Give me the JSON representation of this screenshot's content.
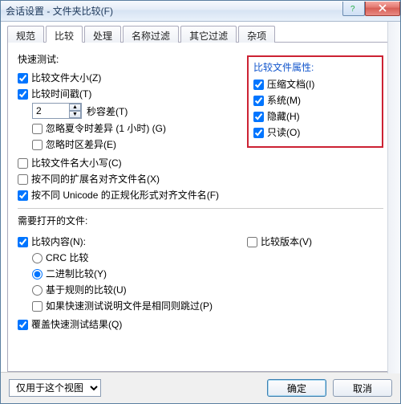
{
  "window": {
    "title": "会话设置 - 文件夹比较(F)"
  },
  "tabs": {
    "items": [
      {
        "label": "规范"
      },
      {
        "label": "比较"
      },
      {
        "label": "处理"
      },
      {
        "label": "名称过滤"
      },
      {
        "label": "其它过滤"
      },
      {
        "label": "杂项"
      }
    ],
    "active_index": 1
  },
  "quick_test": {
    "title": "快速测试:",
    "compare_size": {
      "label": "比较文件大小(Z)",
      "checked": true
    },
    "compare_timestamp": {
      "label": "比较时间戳(T)",
      "checked": true
    },
    "seconds_diff_value": "2",
    "seconds_diff_label": "秒容差(T)",
    "ignore_dst": {
      "label": "忽略夏令时差异 (1 小时) (G)",
      "checked": false
    },
    "ignore_tz": {
      "label": "忽略时区差异(E)",
      "checked": false
    }
  },
  "attributes": {
    "title": "比较文件属性:",
    "items": [
      {
        "label": "压缩文档(I)",
        "checked": true
      },
      {
        "label": "系统(M)",
        "checked": true
      },
      {
        "label": "隐藏(H)",
        "checked": true
      },
      {
        "label": "只读(O)",
        "checked": true
      }
    ]
  },
  "mid_options": {
    "case_sensitive": {
      "label": "比较文件名大小写(C)",
      "checked": false
    },
    "align_ext": {
      "label": "按不同的扩展名对齐文件名(X)",
      "checked": false
    },
    "align_unicode": {
      "label": "按不同 Unicode 的正规化形式对齐文件名(F)",
      "checked": true
    }
  },
  "open_files": {
    "title": "需要打开的文件:",
    "compare_content": {
      "label": "比较内容(N):",
      "checked": true
    },
    "compare_version": {
      "label": "比较版本(V)",
      "checked": false
    },
    "radio": {
      "selected": "binary",
      "crc": "CRC 比较",
      "binary": "二进制比较(Y)",
      "rules": "基于规则的比较(U)"
    },
    "skip_if_same": {
      "label": "如果快速测试说明文件是相同则跳过(P)",
      "checked": false
    },
    "override": {
      "label": "覆盖快速测试结果(Q)",
      "checked": true
    }
  },
  "footer": {
    "scope_selected": "仅用于这个视图",
    "ok": "确定",
    "cancel": "取消"
  }
}
